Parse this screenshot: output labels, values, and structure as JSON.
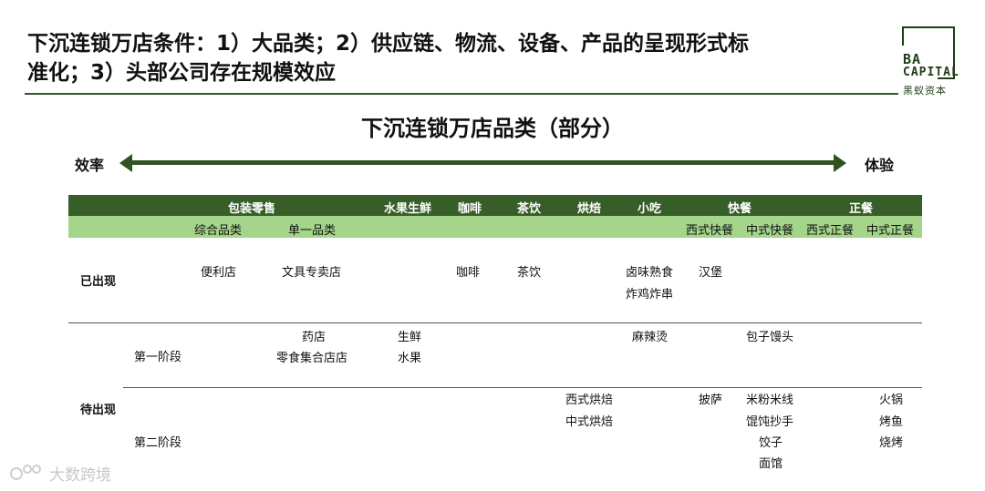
{
  "header": {
    "title_line1": "下沉连锁万店条件：1）大品类；2）供应链、物流、设备、产品的呈现形式标",
    "title_line2": "准化；3）头部公司存在规模效应"
  },
  "logo": {
    "line1": "BA",
    "line2": "CAPITAL",
    "line3": "黑蚁资本"
  },
  "subtitle": "下沉连锁万店品类（部分）",
  "axis": {
    "left": "效率",
    "right": "体验"
  },
  "table": {
    "categories": [
      "包装零售",
      "水果生鲜",
      "咖啡",
      "茶饮",
      "烘焙",
      "小吃",
      "快餐",
      "正餐"
    ],
    "subcategories": [
      "综合品类",
      "单一品类",
      "西式快餐",
      "中式快餐",
      "西式正餐",
      "中式正餐"
    ],
    "rows": {
      "existing": {
        "label": "已出现",
        "cells": [
          "便利店",
          "文具专卖店",
          "咖啡",
          "茶饮",
          "卤味熟食",
          "炸鸡炸串",
          "汉堡"
        ]
      },
      "pending": {
        "label": "待出现",
        "stage1": {
          "label": "第一阶段",
          "cells": [
            "药店",
            "零食集合店店",
            "生鲜",
            "水果",
            "麻辣烫",
            "包子馒头"
          ]
        },
        "stage2": {
          "label": "第二阶段",
          "cells": [
            "西式烘焙",
            "中式烘焙",
            "披萨",
            "米粉米线",
            "馄饨抄手",
            "饺子",
            "面馆",
            "火锅",
            "烤鱼",
            "烧烤"
          ]
        }
      }
    }
  },
  "watermark": "大数跨境"
}
